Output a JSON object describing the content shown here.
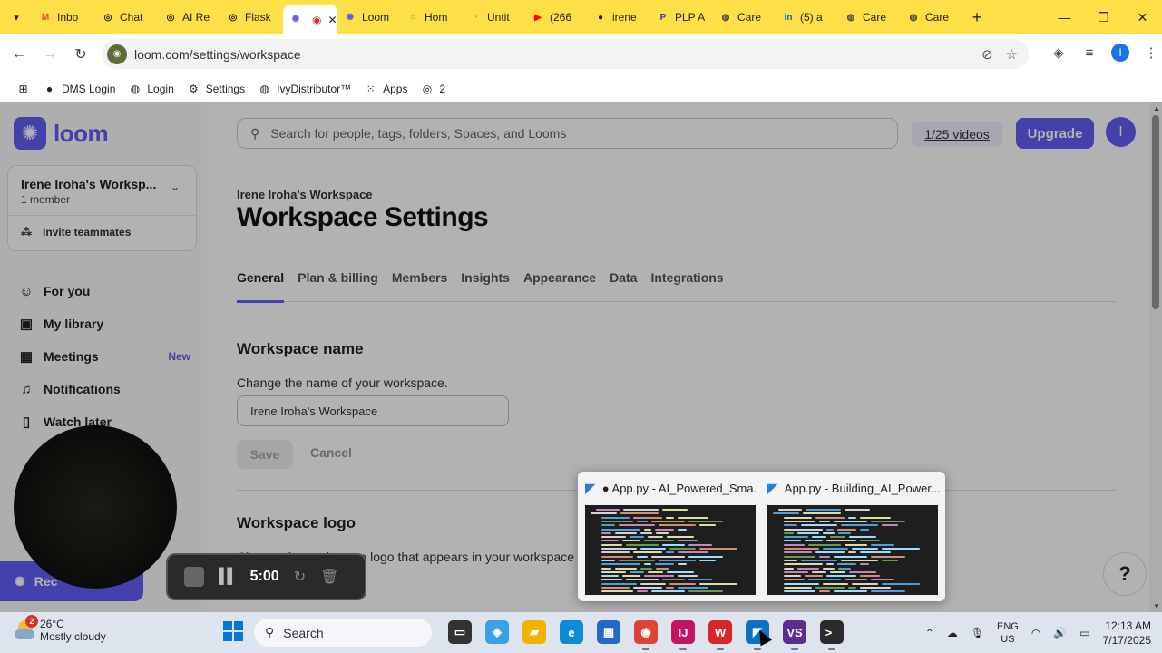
{
  "browser": {
    "tabs": [
      {
        "icon": "gmail-icon",
        "label": "Inbo",
        "color": "#ea4335",
        "glyph": "M"
      },
      {
        "icon": "chatgpt-icon",
        "label": "Chat",
        "color": "#222222",
        "glyph": "◎"
      },
      {
        "icon": "openai-icon",
        "label": "AI Re",
        "color": "#222222",
        "glyph": "◎"
      },
      {
        "icon": "openai-icon",
        "label": "Flask",
        "color": "#222222",
        "glyph": "◎"
      },
      {
        "icon": "loom-icon",
        "label": "",
        "color": "#625df5",
        "glyph": "✺",
        "active": true
      },
      {
        "icon": "loom-icon",
        "label": "Loom",
        "color": "#625df5",
        "glyph": "✺"
      },
      {
        "icon": "home-icon",
        "label": "Hom",
        "color": "#3cb043",
        "glyph": "○"
      },
      {
        "icon": "untitled-icon",
        "label": "Untit",
        "color": "#f4a300",
        "glyph": "◔"
      },
      {
        "icon": "youtube-icon",
        "label": "(266",
        "color": "#ff0000",
        "glyph": "▶"
      },
      {
        "icon": "github-icon",
        "label": "irene",
        "color": "#111111",
        "glyph": "●"
      },
      {
        "icon": "plp-icon",
        "label": "PLP A",
        "color": "#3b3b9b",
        "glyph": "P"
      },
      {
        "icon": "globe-icon",
        "label": "Care",
        "color": "#444444",
        "glyph": "◍"
      },
      {
        "icon": "linkedin-icon",
        "label": "(5) a",
        "color": "#0a66c2",
        "glyph": "in"
      },
      {
        "icon": "globe-icon",
        "label": "Care",
        "color": "#444444",
        "glyph": "◍"
      },
      {
        "icon": "globe-icon",
        "label": "Care",
        "color": "#444444",
        "glyph": "◍"
      }
    ],
    "url": "loom.com/settings/workspace",
    "bookmarks": [
      {
        "icon": "github-icon",
        "label": "DMS Login"
      },
      {
        "icon": "globe-icon",
        "label": "Login"
      },
      {
        "icon": "gear-icon",
        "label": "Settings"
      },
      {
        "icon": "globe-icon",
        "label": "IvyDistributor™"
      },
      {
        "icon": "apps-grid-icon",
        "label": "Apps"
      },
      {
        "icon": "chatgpt-icon",
        "label": "2"
      }
    ],
    "profile_initial": "I"
  },
  "loom": {
    "logo_text": "loom",
    "workspace_name": "Irene Iroha's Worksp...",
    "members": "1 member",
    "invite_label": "Invite teammates",
    "nav": [
      {
        "icon": "person-icon",
        "label": "For you",
        "badge": ""
      },
      {
        "icon": "library-icon",
        "label": "My library",
        "badge": ""
      },
      {
        "icon": "calendar-icon",
        "label": "Meetings",
        "badge": "New"
      },
      {
        "icon": "bell-icon",
        "label": "Notifications",
        "badge": ""
      },
      {
        "icon": "bookmark-icon",
        "label": "Watch later",
        "badge": ""
      }
    ],
    "record_label": "Rec",
    "search_placeholder": "Search for people, tags, folders, Spaces, and Looms",
    "videos_count": "1/25 videos",
    "upgrade_label": "Upgrade",
    "user_initial": "I",
    "breadcrumb": "Irene Iroha's Workspace",
    "page_title": "Workspace Settings",
    "settings_tabs": [
      {
        "label": "General",
        "active": true
      },
      {
        "label": "Plan & billing",
        "active": false
      },
      {
        "label": "Members",
        "active": false
      },
      {
        "label": "Insights",
        "active": false
      },
      {
        "label": "Appearance",
        "active": false
      },
      {
        "label": "Data",
        "active": false
      },
      {
        "label": "Integrations",
        "active": false
      }
    ],
    "workspace_name_section": {
      "title": "Workspace name",
      "description": "Change the name of your workspace.",
      "value": "Irene Iroha's Workspace",
      "save_label": "Save",
      "cancel_label": "Cancel"
    },
    "workspace_logo_section": {
      "title": "Workspace logo",
      "description": "Change the workspace logo that appears in your workspace"
    },
    "help_label": "?"
  },
  "recorder": {
    "timer": "5:00"
  },
  "taskbar_preview": [
    {
      "title": "● App.py - AI_Powered_Sma..."
    },
    {
      "title": "App.py - Building_AI_Power..."
    }
  ],
  "taskbar": {
    "weather_temp": "26°C",
    "weather_desc": "Mostly cloudy",
    "weather_badge": "2",
    "search_label": "Search",
    "apps": [
      {
        "icon": "task-view-icon",
        "glyph": "▭",
        "color": "#333333",
        "running": false
      },
      {
        "icon": "copilot-icon",
        "glyph": "◈",
        "color": "#3aa0e8",
        "running": false
      },
      {
        "icon": "file-explorer-icon",
        "glyph": "▰",
        "color": "#f2b200",
        "running": false
      },
      {
        "icon": "edge-icon",
        "glyph": "e",
        "color": "#0f8ad8",
        "running": false
      },
      {
        "icon": "store-icon",
        "glyph": "▦",
        "color": "#2367c7",
        "running": false
      },
      {
        "icon": "chrome-icon",
        "glyph": "◉",
        "color": "#db4437",
        "running": true
      },
      {
        "icon": "intellij-icon",
        "glyph": "IJ",
        "color": "#c01560",
        "running": true
      },
      {
        "icon": "wps-icon",
        "glyph": "W",
        "color": "#d6262a",
        "running": true
      },
      {
        "icon": "vscode-icon",
        "glyph": "◤",
        "color": "#0e72c4",
        "running": true
      },
      {
        "icon": "visual-studio-icon",
        "glyph": "VS",
        "color": "#5c2d91",
        "running": true
      },
      {
        "icon": "terminal-icon",
        "glyph": ">_",
        "color": "#2b2b2b",
        "running": true
      }
    ],
    "lang": "ENG",
    "region": "US",
    "time": "12:13 AM",
    "date": "7/17/2025"
  }
}
